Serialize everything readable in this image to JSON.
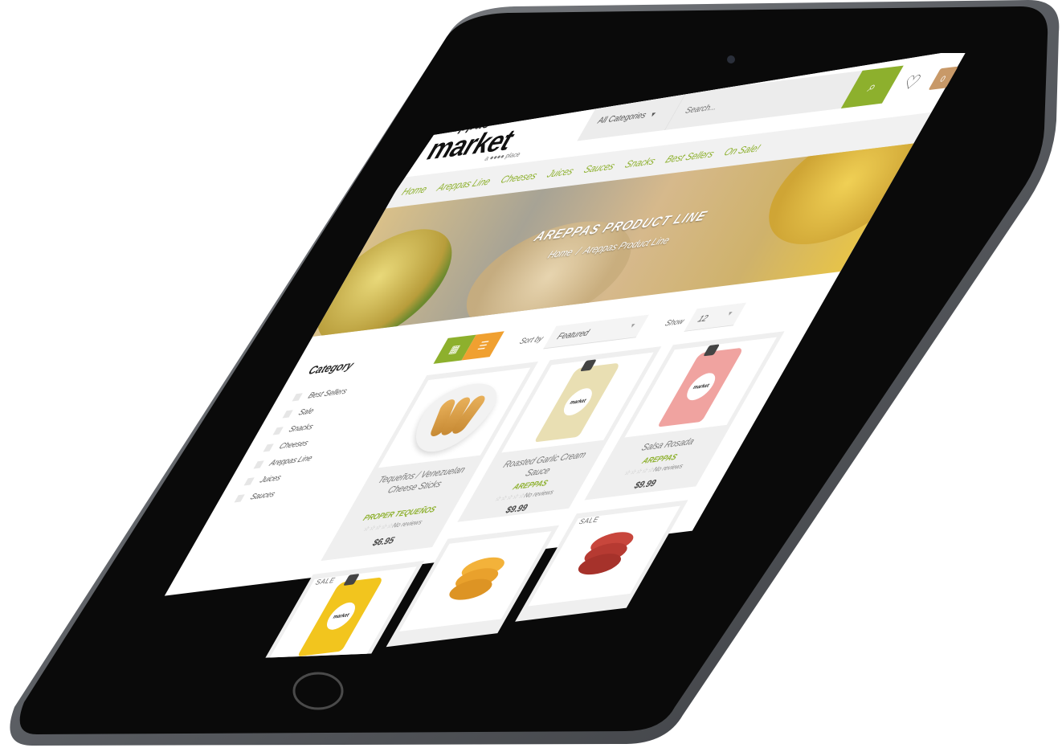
{
  "logo": {
    "line1": "areppas",
    "line2": "market",
    "tagline": "a ●●●● place"
  },
  "search": {
    "category": "All Categories",
    "placeholder": "Search..."
  },
  "nav": [
    "Home",
    "Areppas Line",
    "Cheeses",
    "Juices",
    "Sauces",
    "Snacks",
    "Best Sellers",
    "On Sale!"
  ],
  "banner": {
    "title": "AREPPAS PRODUCT LINE",
    "breadcrumb_home": "Home",
    "breadcrumb_sep": "/",
    "breadcrumb_current": "Areppas Product Line"
  },
  "sidebar": {
    "title": "Category",
    "items": [
      "Best Sellers",
      "Sale",
      "Snacks",
      "Cheeses",
      "Areppas Line",
      "Juices",
      "Sauces"
    ]
  },
  "toolbar": {
    "sort_label": "Sort by",
    "sort_value": "Featured",
    "show_label": "Show",
    "show_value": "12"
  },
  "products": [
    {
      "name": "Tequeños / Venezuelan Cheese Sticks",
      "brand": "PROPER TEQUEÑOS",
      "reviews": "No reviews",
      "price": "$6.95"
    },
    {
      "name": "Roasted Garlic Cream Sauce",
      "brand": "AREPPAS",
      "reviews": "No reviews",
      "price": "$9.99"
    },
    {
      "name": "Salsa Rosada",
      "brand": "AREPPAS",
      "reviews": "No reviews",
      "price": "$9.99"
    }
  ],
  "product_row2": [
    {
      "badge": "SALE"
    },
    {
      "badge": ""
    },
    {
      "badge": "SALE"
    }
  ],
  "pouch_label": "market",
  "icons": {
    "search": "search-icon",
    "wishlist": "heart-icon",
    "cart": "shopping-bag-icon",
    "grid": "grid-view-icon",
    "list": "list-view-icon",
    "stars": "☆☆☆☆☆"
  },
  "colors": {
    "accent_green": "#8db02d",
    "accent_orange": "#f0a030",
    "device": "#0a0a0a",
    "bezel": "#6b6e73"
  }
}
